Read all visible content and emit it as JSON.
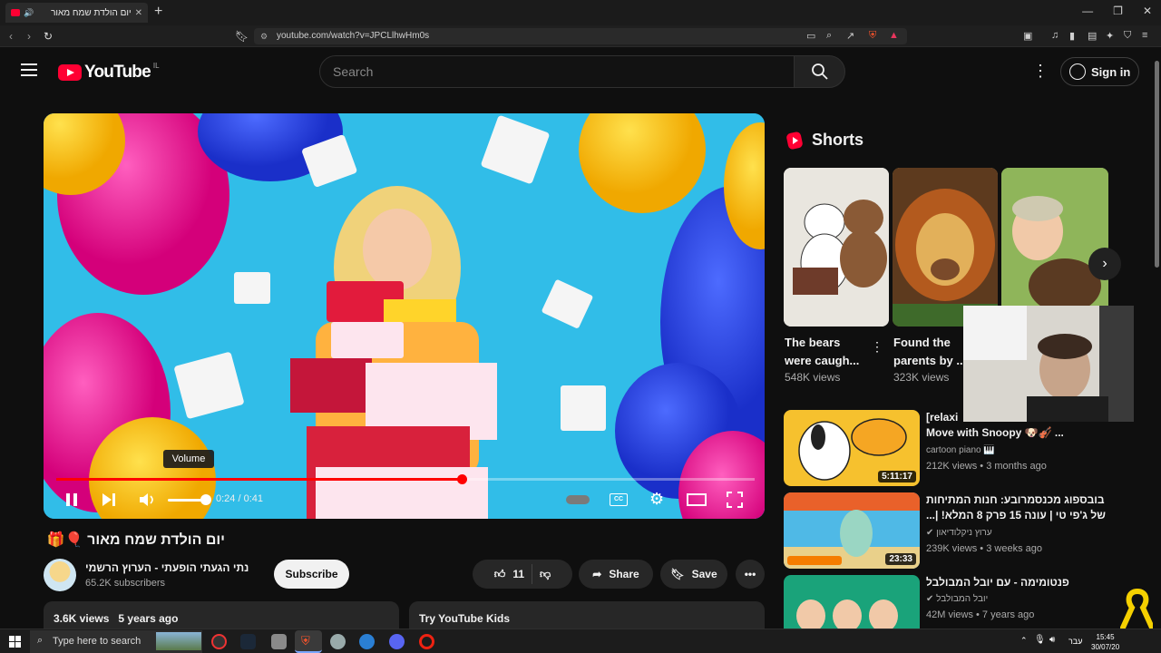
{
  "browser": {
    "tab_title": "יום הולדת שמח מאור",
    "new_tab_label": "+",
    "url": "youtube.com/watch?v=JPCLlhwHm0s"
  },
  "header": {
    "logo_text": "YouTube",
    "country": "IL",
    "search_placeholder": "Search",
    "signin_label": "Sign in"
  },
  "player": {
    "time": "0:24 / 0:41",
    "progress": 0.58,
    "volume": 0.85,
    "tooltip": "Volume"
  },
  "video": {
    "title": "יום הולדת שמח מאור",
    "title_emoji": "🎈🎁",
    "channel_name": "נתי הגעתי הופעתי - הערוץ הרשמי",
    "subscribers": "65.2K subscribers",
    "subscribe_label": "Subscribe",
    "likes": "11",
    "share_label": "Share",
    "save_label": "Save",
    "views": "3.6K views",
    "age": "5 years ago",
    "kids_label": "Try YouTube Kids"
  },
  "shorts": {
    "heading": "Shorts",
    "items": [
      {
        "title": "The bears were caugh...",
        "views": "548K views"
      },
      {
        "title": "Found the parents by ...",
        "views": "323K views"
      }
    ]
  },
  "recommended": [
    {
      "title_prefix": "[relaxi",
      "title": "Move with Snoopy 🐶🎻 ...",
      "channel": "cartoon piano 🎹",
      "meta": "212K views • 3 months ago",
      "duration": "5:11:17"
    },
    {
      "title": "בובספוג מכנסמרובע: חנות המתיחות של ג'פי טי | עונה 15 פרק 8 המלא! |...",
      "channel": "ערוץ ניקלודיאון",
      "meta": "239K views • 3 weeks ago",
      "duration": "23:33"
    },
    {
      "title": "פנטומימה - עם יובל המבולבל",
      "channel": "יובל המבולבל",
      "meta": "42M views • 7 years ago",
      "duration": ""
    }
  ],
  "taskbar": {
    "search_placeholder": "Type here to search",
    "lang": "עבר",
    "time": "15:45",
    "date": "30/07/20"
  },
  "colors": {
    "accent": "#ff0033",
    "bg": "#0f0f0f"
  }
}
